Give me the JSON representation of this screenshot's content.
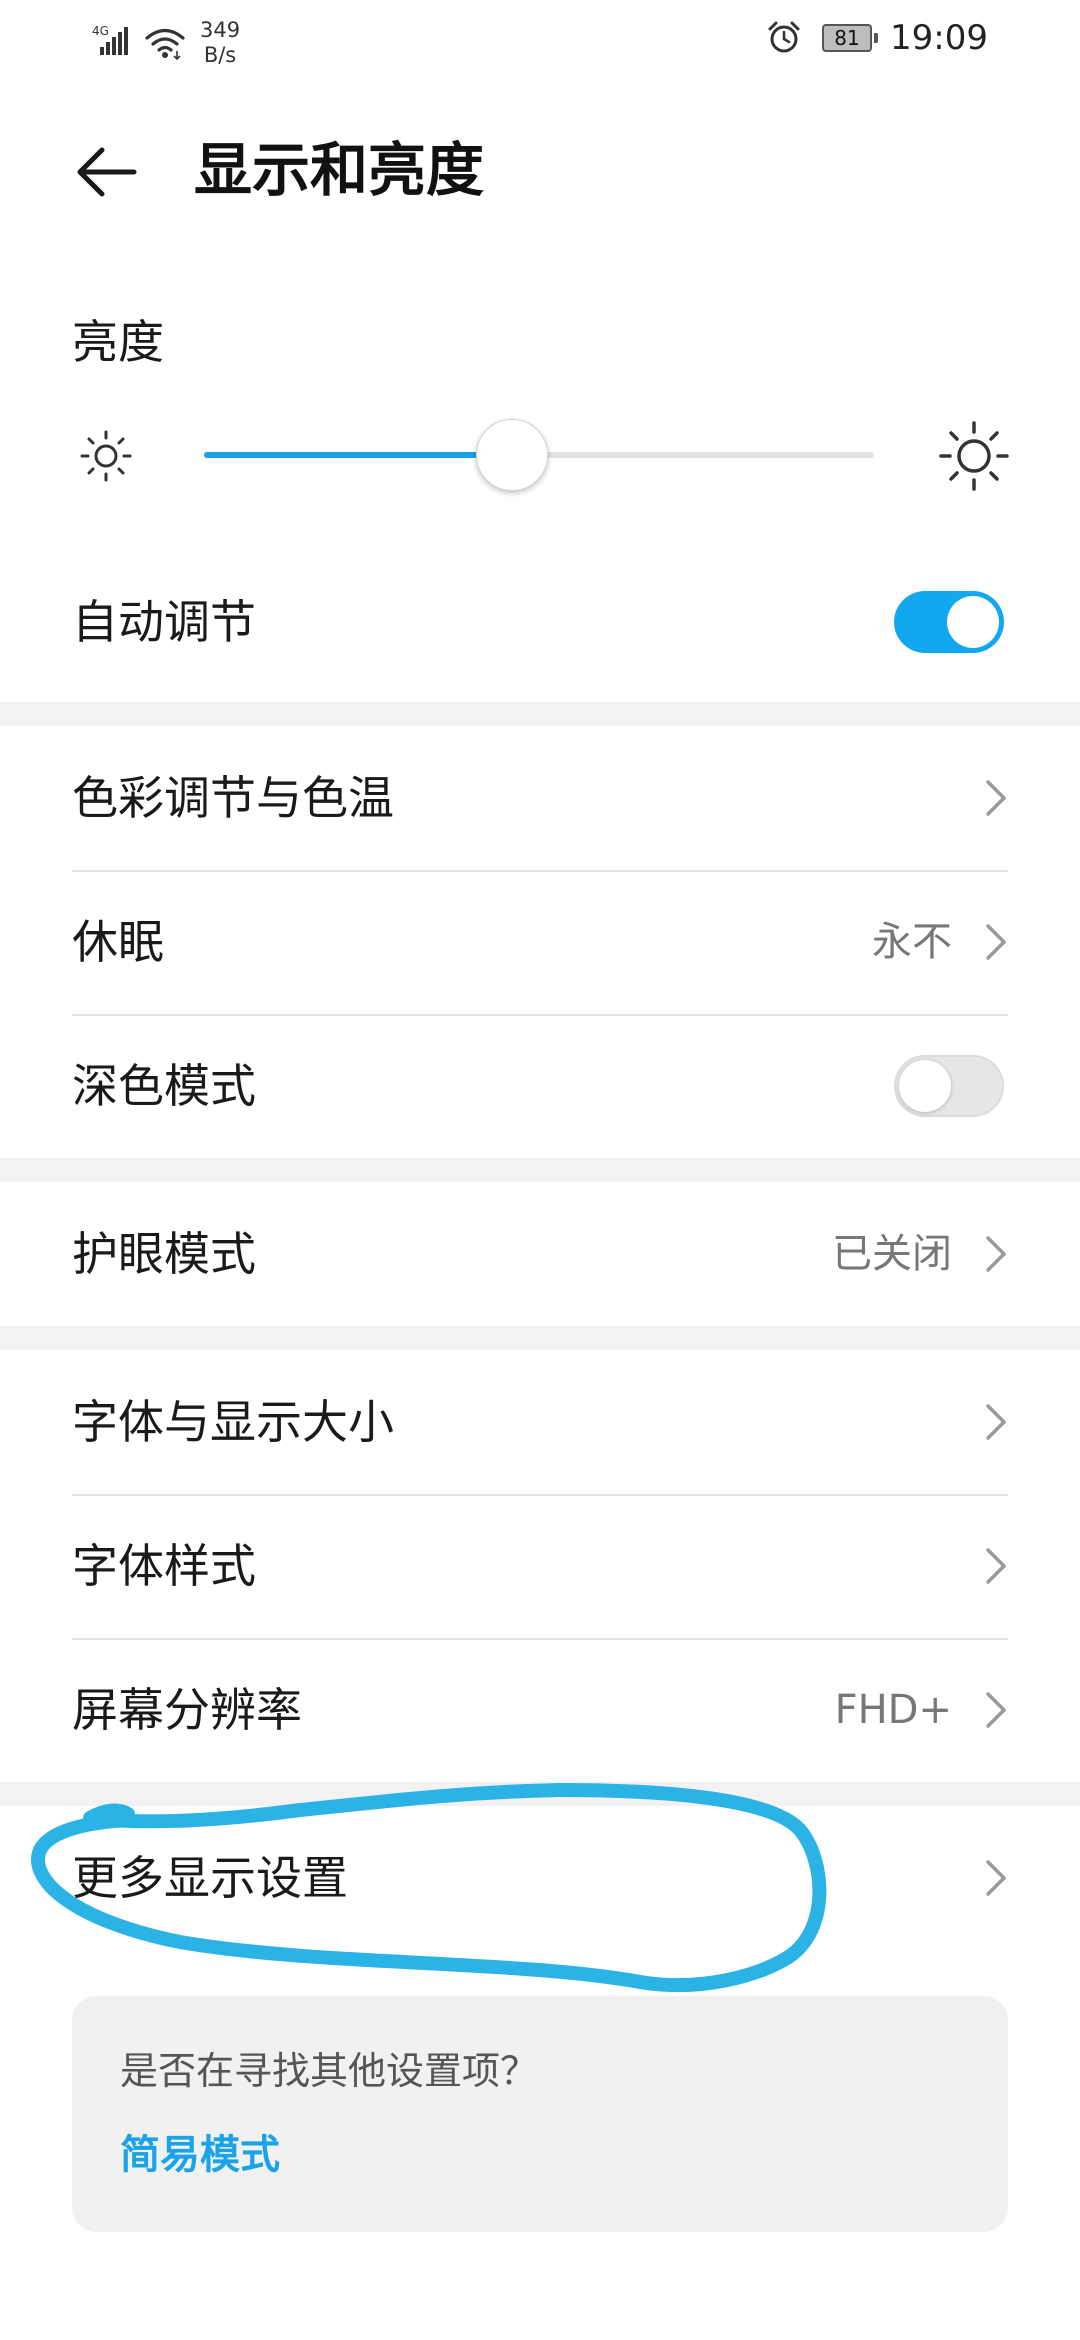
{
  "status_bar": {
    "network_type": "4G",
    "speed_value": "349",
    "speed_unit": "B/s",
    "battery_level": "81",
    "time": "19:09",
    "icons": [
      "signal-icon",
      "wifi-icon",
      "alarm-icon",
      "battery-icon"
    ]
  },
  "header": {
    "title": "显示和亮度",
    "back_icon": "back-arrow-icon"
  },
  "brightness": {
    "label": "亮度",
    "level_percent": 46,
    "min_icon": "sun-small-icon",
    "max_icon": "sun-large-icon",
    "auto_label": "自动调节",
    "auto_enabled": true
  },
  "groups": {
    "display": {
      "items": [
        {
          "label": "色彩调节与色温",
          "value": ""
        },
        {
          "label": "休眠",
          "value": "永不"
        },
        {
          "label": "深色模式",
          "value": ""
        }
      ],
      "dark_mode_enabled": false
    },
    "eye": {
      "label": "护眼模式",
      "value": "已关闭"
    },
    "font": {
      "items": [
        {
          "label": "字体与显示大小",
          "value": ""
        },
        {
          "label": "字体样式",
          "value": ""
        },
        {
          "label": "屏幕分辨率",
          "value": "FHD+"
        }
      ]
    },
    "more": {
      "label": "更多显示设置"
    }
  },
  "suggestion": {
    "question": "是否在寻找其他设置项？",
    "link": "简易模式"
  },
  "colors": {
    "accent": "#1aa3e8",
    "annotation": "#2bb3e6",
    "background": "#f2f2f2",
    "card": "#ffffff"
  }
}
